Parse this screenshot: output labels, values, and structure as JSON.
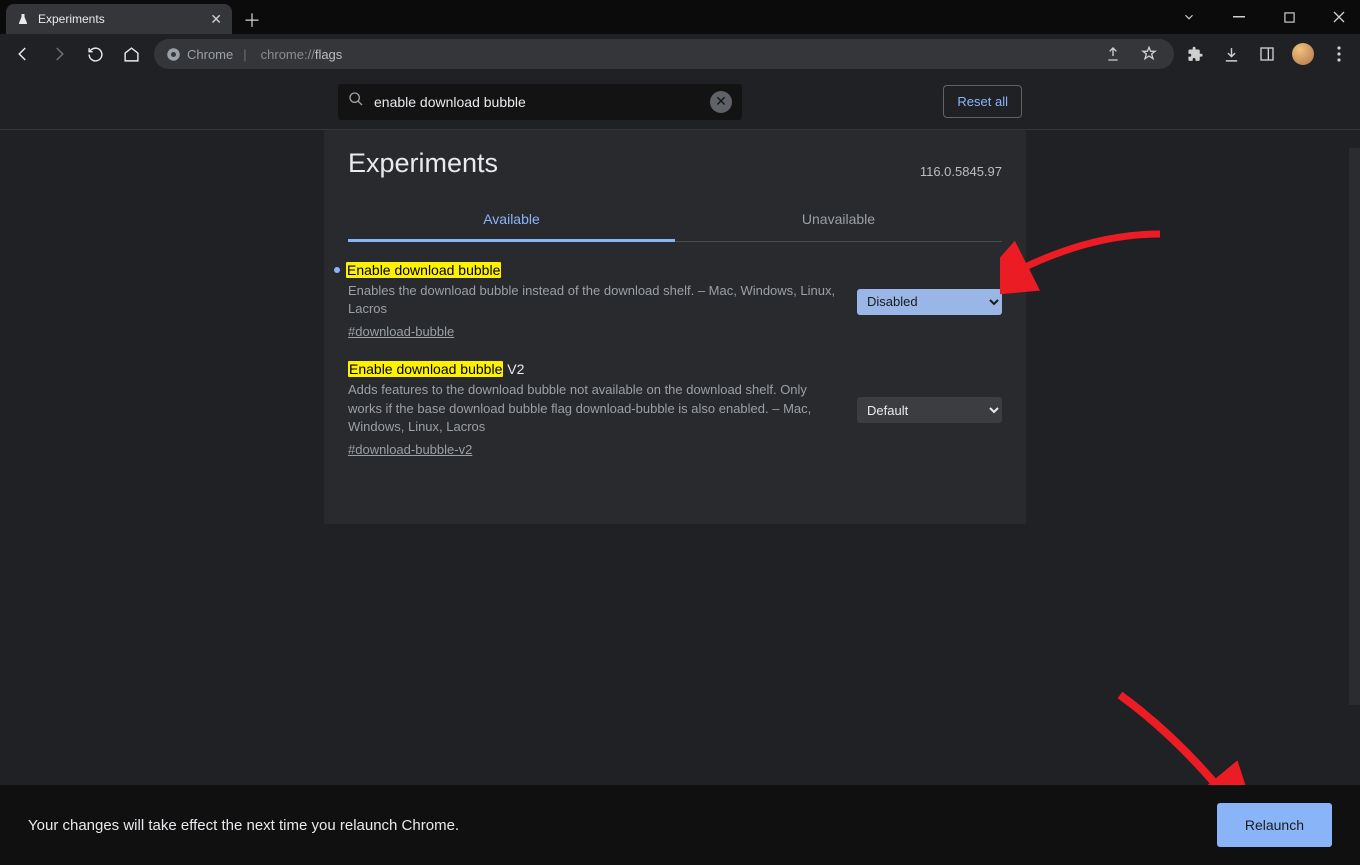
{
  "tab": {
    "title": "Experiments"
  },
  "omnibox": {
    "site_label": "Chrome",
    "url_dim": "chrome://",
    "url_bold": "flags"
  },
  "search": {
    "value": "enable download bubble",
    "reset": "Reset all"
  },
  "card": {
    "title": "Experiments",
    "version": "116.0.5845.97",
    "tab_available": "Available",
    "tab_unavailable": "Unavailable"
  },
  "flags": [
    {
      "name_hl": "Enable download bubble",
      "name_rest": "",
      "desc": "Enables the download bubble instead of the download shelf. – Mac, Windows, Linux, Lacros",
      "anchor": "#download-bubble",
      "select": "Disabled",
      "select_class": "changed",
      "bullet": true
    },
    {
      "name_hl": "Enable download bubble",
      "name_rest": " V2",
      "desc": "Adds features to the download bubble not available on the download shelf. Only works if the base download bubble flag download-bubble is also enabled. – Mac, Windows, Linux, Lacros",
      "anchor": "#download-bubble-v2",
      "select": "Default",
      "select_class": "default",
      "bullet": false
    }
  ],
  "footer": {
    "message": "Your changes will take effect the next time you relaunch Chrome.",
    "button": "Relaunch"
  }
}
